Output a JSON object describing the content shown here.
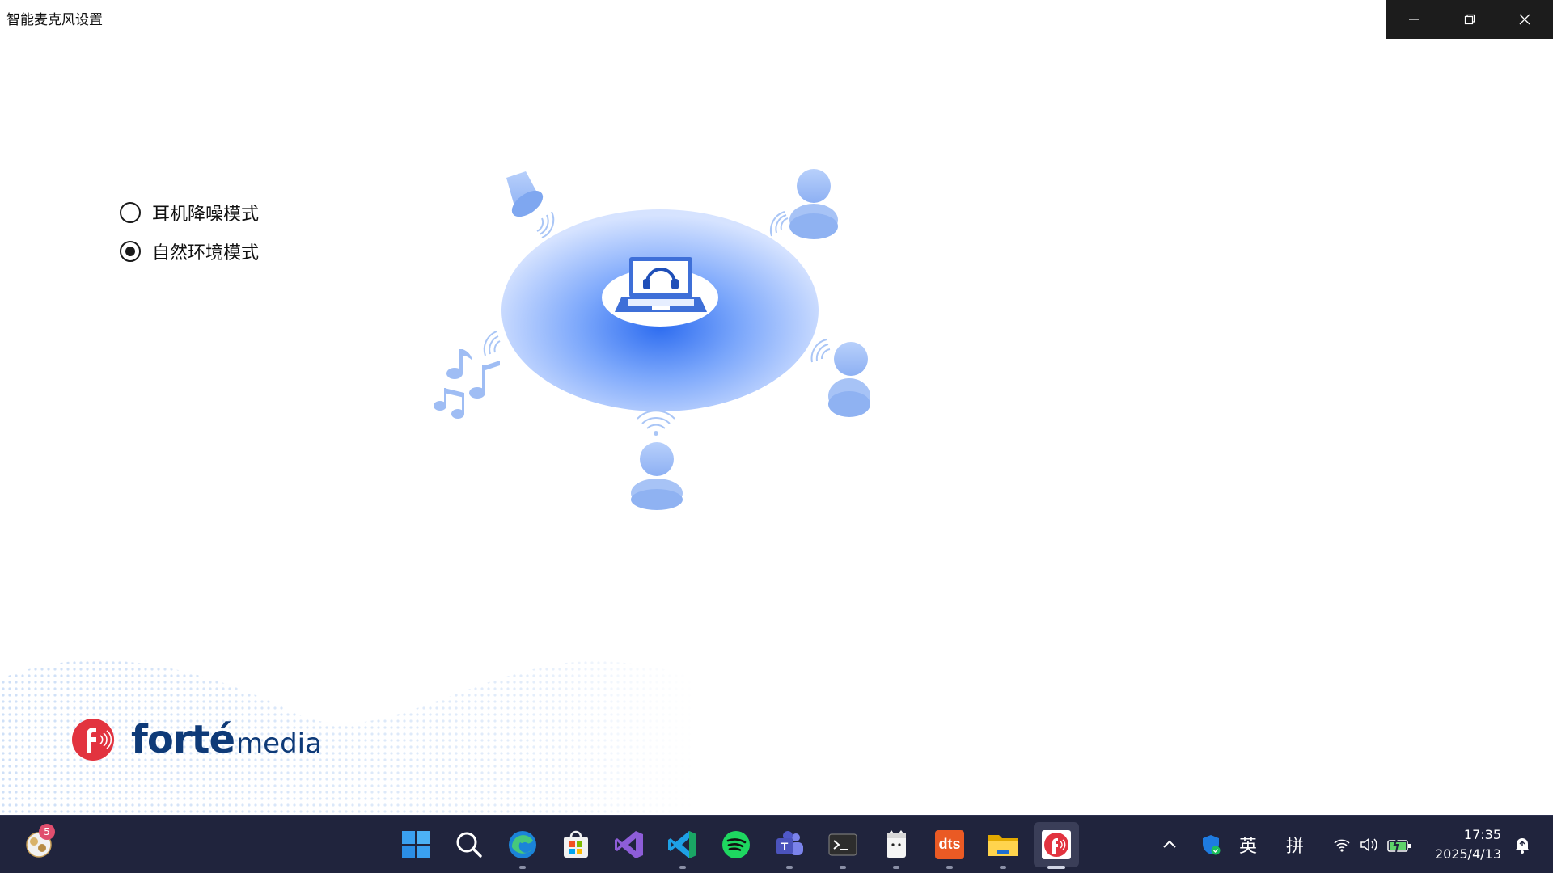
{
  "window": {
    "title": "智能麦克风设置",
    "controls": [
      "minimize-icon",
      "restore-icon",
      "close-icon"
    ]
  },
  "modes": {
    "options": [
      {
        "label": "耳机降噪模式",
        "selected": false
      },
      {
        "label": "自然环境模式",
        "selected": true
      }
    ]
  },
  "illustration": {
    "icons": [
      "speaker-icon",
      "person-icon",
      "music-notes-icon",
      "laptop-headset-icon",
      "wifi-signal-icon"
    ],
    "colors": {
      "light": "#c9dbff",
      "mid": "#8fb4ff",
      "deep": "#3f7ef5",
      "figure": "#9cbcf5"
    }
  },
  "brand": {
    "name_bold": "forté",
    "name_light": "media",
    "color_text": "#0e3a78",
    "color_mark": "#e2333f"
  },
  "taskbar": {
    "widget_badge": "5",
    "apps": [
      {
        "name": "start",
        "icon": "windows-icon",
        "running": false
      },
      {
        "name": "search",
        "icon": "search-icon",
        "running": false
      },
      {
        "name": "edge",
        "icon": "edge-icon",
        "running": true
      },
      {
        "name": "store",
        "icon": "store-icon",
        "running": false
      },
      {
        "name": "visual-studio",
        "icon": "visual-studio-icon",
        "running": false
      },
      {
        "name": "vscode",
        "icon": "vscode-icon",
        "running": true
      },
      {
        "name": "spotify",
        "icon": "spotify-icon",
        "running": false
      },
      {
        "name": "teams",
        "icon": "teams-icon",
        "running": true
      },
      {
        "name": "terminal",
        "icon": "terminal-icon",
        "running": true
      },
      {
        "name": "notepad",
        "icon": "notepad-icon",
        "running": true
      },
      {
        "name": "dts",
        "icon": "dts-icon",
        "label": "dts",
        "running": true
      },
      {
        "name": "explorer",
        "icon": "folder-icon",
        "running": true
      },
      {
        "name": "smart-mic",
        "icon": "fortemedia-icon",
        "running": true,
        "active": true
      }
    ],
    "tray": {
      "ime_lang": "英",
      "ime_mode": "拼",
      "icons": [
        "chevron-up-icon",
        "security-shield-icon",
        "wifi-icon",
        "volume-icon",
        "battery-icon",
        "notification-icon"
      ]
    },
    "clock": {
      "time": "17:35",
      "date": "2025/4/13"
    }
  }
}
